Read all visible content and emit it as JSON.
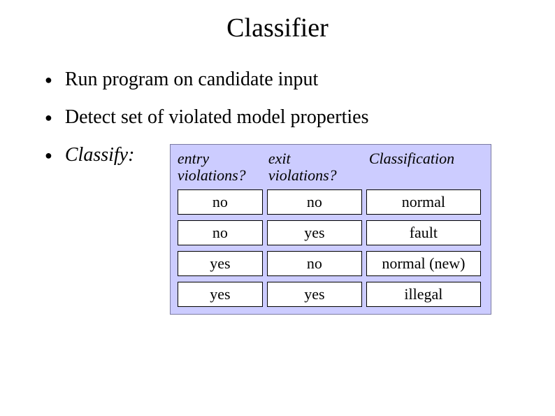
{
  "title": "Classifier",
  "bullets": {
    "b1": "Run program on candidate input",
    "b2": "Detect set of violated model properties",
    "b3": "Classify:"
  },
  "table": {
    "headers": {
      "h1a": "entry",
      "h1b": "violations?",
      "h2a": "exit",
      "h2b": "violations?",
      "h3": "Classification"
    },
    "rows": [
      {
        "c1": "no",
        "c2": "no",
        "c3": "normal"
      },
      {
        "c1": "no",
        "c2": "yes",
        "c3": "fault"
      },
      {
        "c1": "yes",
        "c2": "no",
        "c3": "normal (new)"
      },
      {
        "c1": "yes",
        "c2": "yes",
        "c3": "illegal"
      }
    ]
  },
  "chart_data": {
    "type": "table",
    "title": "Classifier",
    "columns": [
      "entry violations?",
      "exit violations?",
      "Classification"
    ],
    "rows": [
      [
        "no",
        "no",
        "normal"
      ],
      [
        "no",
        "yes",
        "fault"
      ],
      [
        "yes",
        "no",
        "normal (new)"
      ],
      [
        "yes",
        "yes",
        "illegal"
      ]
    ]
  }
}
